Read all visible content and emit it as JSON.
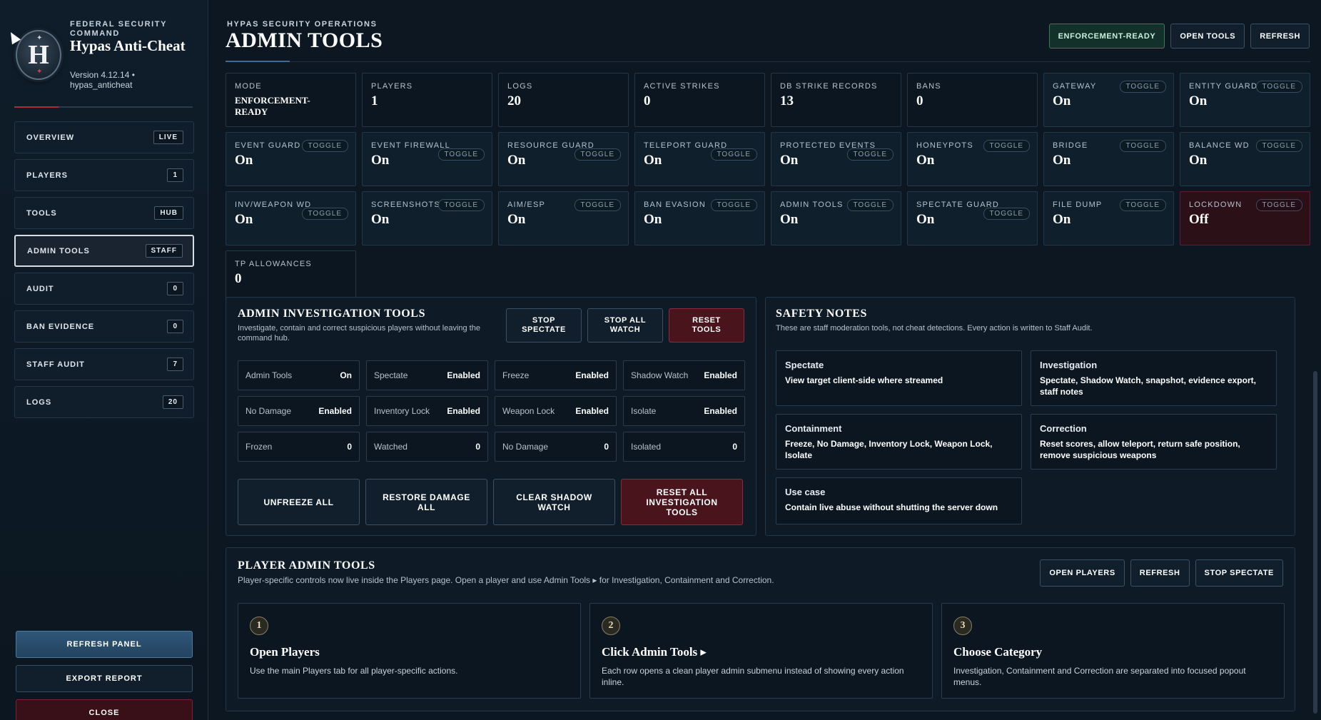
{
  "sidebar": {
    "brand": {
      "subtitle": "FEDERAL SECURITY COMMAND",
      "title": "Hypas Anti-Cheat",
      "version": "Version 4.12.14 • hypas_anticheat",
      "logo_letter": "H"
    },
    "nav": [
      {
        "label": "OVERVIEW",
        "badge": "LIVE"
      },
      {
        "label": "PLAYERS",
        "badge": "1"
      },
      {
        "label": "TOOLS",
        "badge": "HUB"
      },
      {
        "label": "ADMIN TOOLS",
        "badge": "STAFF"
      },
      {
        "label": "AUDIT",
        "badge": "0"
      },
      {
        "label": "BAN EVIDENCE",
        "badge": "0"
      },
      {
        "label": "STAFF AUDIT",
        "badge": "7"
      },
      {
        "label": "LOGS",
        "badge": "20"
      }
    ],
    "refresh_panel": "REFRESH PANEL",
    "export_report": "EXPORT REPORT",
    "close": "CLOSE"
  },
  "header": {
    "eyebrow": "HYPAS SECURITY OPERATIONS",
    "title": "ADMIN TOOLS",
    "status_button": "ENFORCEMENT-READY",
    "open_tools": "OPEN TOOLS",
    "refresh": "REFRESH"
  },
  "toggle_label": "TOGGLE",
  "stats": [
    {
      "label": "MODE",
      "value": "ENFORCEMENT-READY",
      "toggle": false
    },
    {
      "label": "PLAYERS",
      "value": "1",
      "toggle": false
    },
    {
      "label": "LOGS",
      "value": "20",
      "toggle": false
    },
    {
      "label": "ACTIVE STRIKES",
      "value": "0",
      "toggle": false
    },
    {
      "label": "DB STRIKE RECORDS",
      "value": "13",
      "toggle": false
    },
    {
      "label": "BANS",
      "value": "0",
      "toggle": false
    },
    {
      "label": "GATEWAY",
      "value": "On",
      "toggle": true
    },
    {
      "label": "ENTITY GUARD",
      "value": "On",
      "toggle": true
    },
    {
      "label": "EVENT GUARD",
      "value": "On",
      "toggle": true
    },
    {
      "label": "EVENT FIREWALL",
      "value": "On",
      "toggle": true
    },
    {
      "label": "RESOURCE GUARD",
      "value": "On",
      "toggle": true
    },
    {
      "label": "TELEPORT GUARD",
      "value": "On",
      "toggle": true
    },
    {
      "label": "PROTECTED EVENTS",
      "value": "On",
      "toggle": true
    },
    {
      "label": "HONEYPOTS",
      "value": "On",
      "toggle": true
    },
    {
      "label": "BRIDGE",
      "value": "On",
      "toggle": true
    },
    {
      "label": "BALANCE WD",
      "value": "On",
      "toggle": true
    },
    {
      "label": "INV/WEAPON WD",
      "value": "On",
      "toggle": true
    },
    {
      "label": "SCREENSHOTS",
      "value": "On",
      "toggle": true
    },
    {
      "label": "AIM/ESP",
      "value": "On",
      "toggle": true
    },
    {
      "label": "BAN EVASION",
      "value": "On",
      "toggle": true
    },
    {
      "label": "ADMIN TOOLS",
      "value": "On",
      "toggle": true
    },
    {
      "label": "SPECTATE GUARD",
      "value": "On",
      "toggle": true
    },
    {
      "label": "FILE DUMP",
      "value": "On",
      "toggle": true
    },
    {
      "label": "LOCKDOWN",
      "value": "Off",
      "toggle": true
    },
    {
      "label": "TP ALLOWANCES",
      "value": "0",
      "toggle": false
    }
  ],
  "investigation": {
    "title": "ADMIN INVESTIGATION TOOLS",
    "subtitle": "Investigate, contain and correct suspicious players without leaving the command hub.",
    "stop_spectate": "STOP SPECTATE",
    "stop_all_watch": "STOP ALL WATCH",
    "reset_tools": "RESET TOOLS",
    "cells": [
      {
        "label": "Admin Tools",
        "value": "On"
      },
      {
        "label": "Spectate",
        "value": "Enabled"
      },
      {
        "label": "Freeze",
        "value": "Enabled"
      },
      {
        "label": "Shadow Watch",
        "value": "Enabled"
      },
      {
        "label": "No Damage",
        "value": "Enabled"
      },
      {
        "label": "Inventory Lock",
        "value": "Enabled"
      },
      {
        "label": "Weapon Lock",
        "value": "Enabled"
      },
      {
        "label": "Isolate",
        "value": "Enabled"
      },
      {
        "label": "Frozen",
        "value": "0"
      },
      {
        "label": "Watched",
        "value": "0"
      },
      {
        "label": "No Damage",
        "value": "0"
      },
      {
        "label": "Isolated",
        "value": "0"
      }
    ],
    "unfreeze_all": "UNFREEZE ALL",
    "restore_damage_all": "RESTORE DAMAGE ALL",
    "clear_shadow_watch": "CLEAR SHADOW WATCH",
    "reset_all": "RESET ALL INVESTIGATION TOOLS"
  },
  "safety": {
    "title": "SAFETY NOTES",
    "subtitle": "These are staff moderation tools, not cheat detections. Every action is written to Staff Audit.",
    "notes": [
      {
        "title": "Spectate",
        "body": "View target client-side where streamed"
      },
      {
        "title": "Investigation",
        "body": "Spectate, Shadow Watch, snapshot, evidence export, staff notes"
      },
      {
        "title": "Containment",
        "body": "Freeze, No Damage, Inventory Lock, Weapon Lock, Isolate"
      },
      {
        "title": "Correction",
        "body": "Reset scores, allow teleport, return safe position, remove suspicious weapons"
      },
      {
        "title": "Use case",
        "body": "Contain live abuse without shutting the server down"
      }
    ]
  },
  "player_tools": {
    "title": "PLAYER ADMIN TOOLS",
    "subtitle": "Player-specific controls now live inside the Players page. Open a player and use Admin Tools ▸ for Investigation, Containment and Correction.",
    "open_players": "OPEN PLAYERS",
    "refresh": "REFRESH",
    "stop_spectate": "STOP SPECTATE",
    "steps": [
      {
        "num": "1",
        "title": "Open Players",
        "body": "Use the main Players tab for all player-specific actions."
      },
      {
        "num": "2",
        "title": "Click Admin Tools ▸",
        "body": "Each row opens a clean player admin submenu instead of showing every action inline."
      },
      {
        "num": "3",
        "title": "Choose Category",
        "body": "Investigation, Containment and Correction are separated into focused popout menus."
      }
    ]
  },
  "colors": {
    "background": "#0c1722",
    "accent_blue": "#2f5678",
    "danger": "#4a141d",
    "ready_green": "#14302a"
  }
}
